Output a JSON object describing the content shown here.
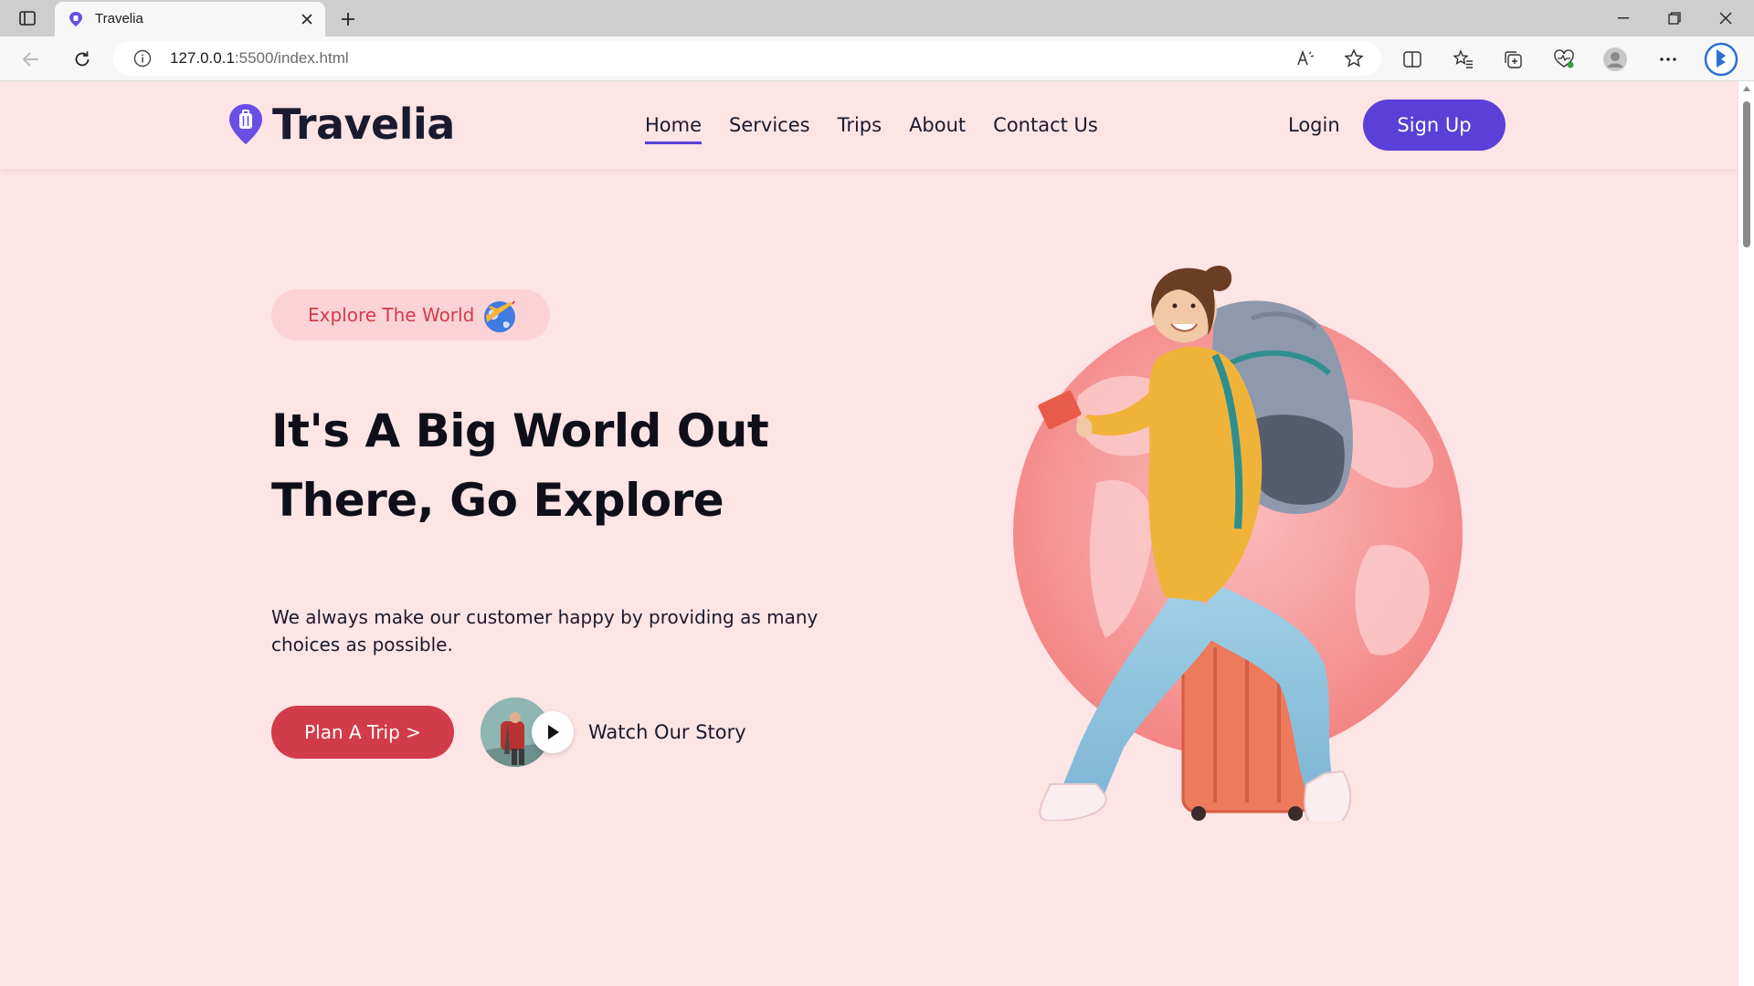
{
  "browser": {
    "tab_title": "Travelia",
    "url_host": "127.0.0.1",
    "url_rest": ":5500/index.html"
  },
  "nav": {
    "brand": "Travelia",
    "links": [
      {
        "label": "Home",
        "active": true
      },
      {
        "label": "Services",
        "active": false
      },
      {
        "label": "Trips",
        "active": false
      },
      {
        "label": "About",
        "active": false
      },
      {
        "label": "Contact Us",
        "active": false
      }
    ],
    "login_label": "Login",
    "signup_label": "Sign Up"
  },
  "hero": {
    "badge": "Explore The World",
    "badge_icon": "globe-plane-icon",
    "title_line1": "It's A Big World Out",
    "title_line2": "There, Go Explore",
    "description": "We always make our customer happy by providing as many choices as possible.",
    "cta_label": "Plan A Trip >",
    "story_label": "Watch Our Story"
  },
  "colors": {
    "page_bg": "#fde4e5",
    "brand_purple": "#5a3fd8",
    "cta_red": "#d23b4a",
    "badge_bg": "#fbd3d6",
    "globe_pink": "#f58a8a"
  }
}
